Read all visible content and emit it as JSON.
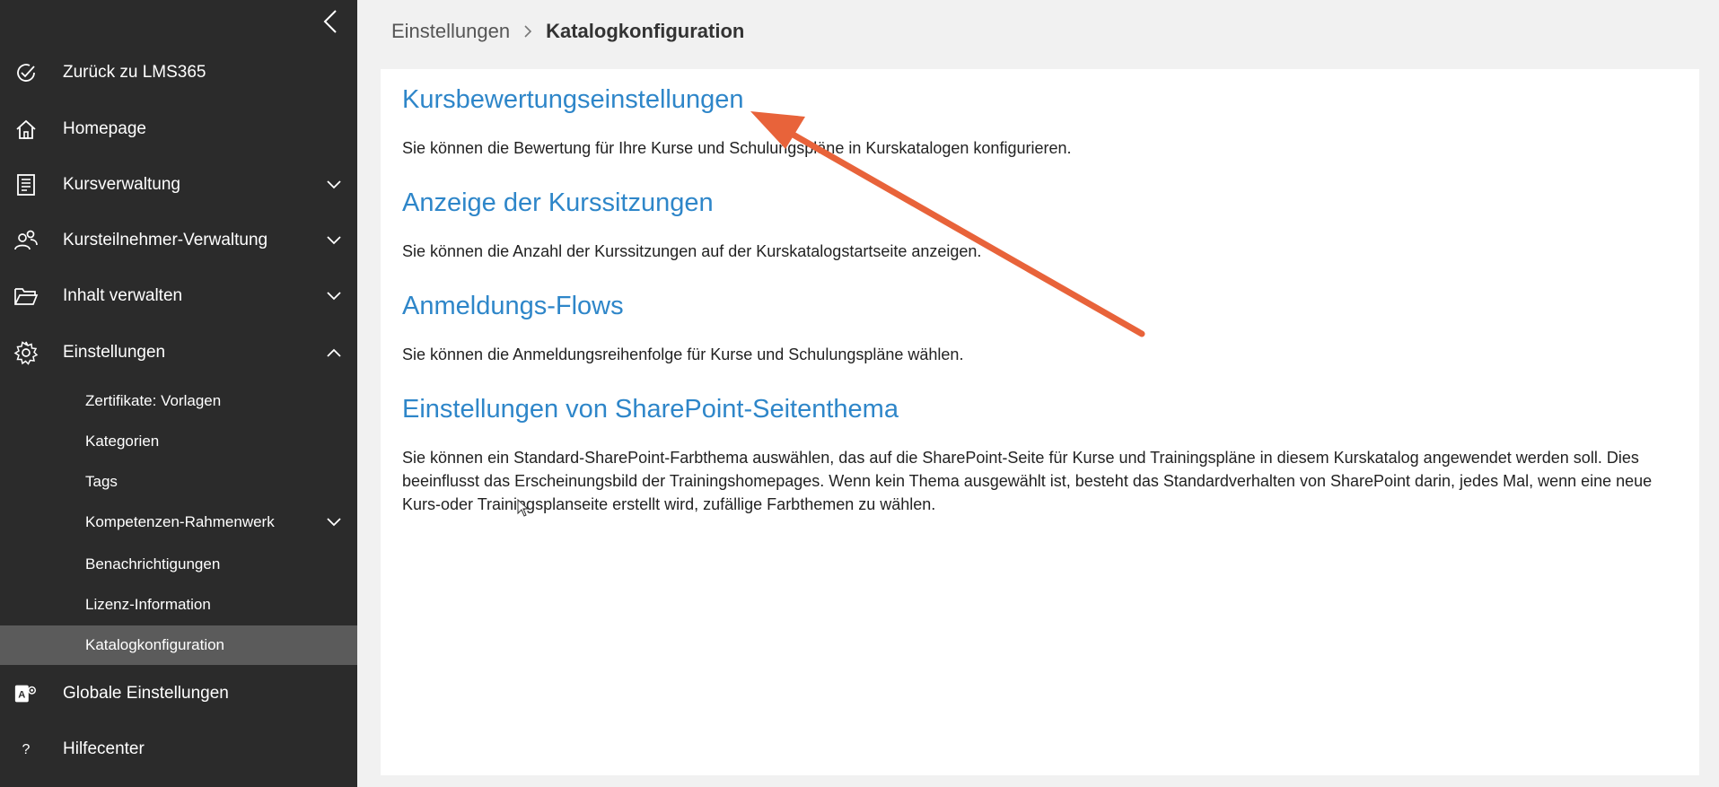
{
  "sidebar": {
    "items": [
      {
        "label": "Zurück zu LMS365",
        "icon": "check-circle-icon"
      },
      {
        "label": "Homepage",
        "icon": "home-icon"
      },
      {
        "label": "Kursverwaltung",
        "icon": "document-list-icon",
        "expandable": true
      },
      {
        "label": "Kursteilnehmer-Verwaltung",
        "icon": "people-icon",
        "expandable": true
      },
      {
        "label": "Inhalt verwalten",
        "icon": "folder-icon",
        "expandable": true
      },
      {
        "label": "Einstellungen",
        "icon": "gear-icon",
        "expanded": true
      }
    ],
    "subitems": [
      {
        "label": "Zertifikate: Vorlagen"
      },
      {
        "label": "Kategorien"
      },
      {
        "label": "Tags"
      },
      {
        "label": "Kompetenzen-Rahmenwerk",
        "expandable": true
      },
      {
        "label": "Benachrichtigungen"
      },
      {
        "label": "Lizenz-Information"
      },
      {
        "label": "Katalogkonfiguration",
        "active": true
      }
    ],
    "bottom_items": [
      {
        "label": "Globale Einstellungen",
        "icon": "admin-settings-icon"
      },
      {
        "label": "Hilfecenter",
        "icon": "question-icon"
      }
    ]
  },
  "breadcrumb": {
    "parent": "Einstellungen",
    "current": "Katalogkonfiguration"
  },
  "sections": [
    {
      "title": "Kursbewertungseinstellungen",
      "description": "Sie können die Bewertung für Ihre Kurse und Schulungspläne in Kurskatalogen konfigurieren."
    },
    {
      "title": "Anzeige der Kurssitzungen",
      "description": "Sie können die Anzahl der Kurssitzungen auf der Kurskatalogstartseite anzeigen."
    },
    {
      "title": "Anmeldungs-Flows",
      "description": "Sie können die Anmeldungsreihenfolge für Kurse und Schulungspläne wählen."
    },
    {
      "title": "Einstellungen von SharePoint-Seitenthema",
      "description": "Sie können ein Standard-SharePoint-Farbthema auswählen, das auf die SharePoint-Seite für Kurse und Trainingspläne in diesem Kurskatalog angewendet werden soll. Dies beeinflusst das Erscheinungsbild der Trainingshomepages. Wenn kein Thema ausgewählt ist, besteht das Standardverhalten von SharePoint darin, jedes Mal, wenn eine neue Kurs-oder Trainingsplanseite erstellt wird, zufällige Farbthemen zu wählen."
    }
  ],
  "colors": {
    "sidebar_bg": "#2b2b2b",
    "active_bg": "#5b5b5b",
    "link": "#2e86c9",
    "annotation_arrow": "#e8633a"
  }
}
